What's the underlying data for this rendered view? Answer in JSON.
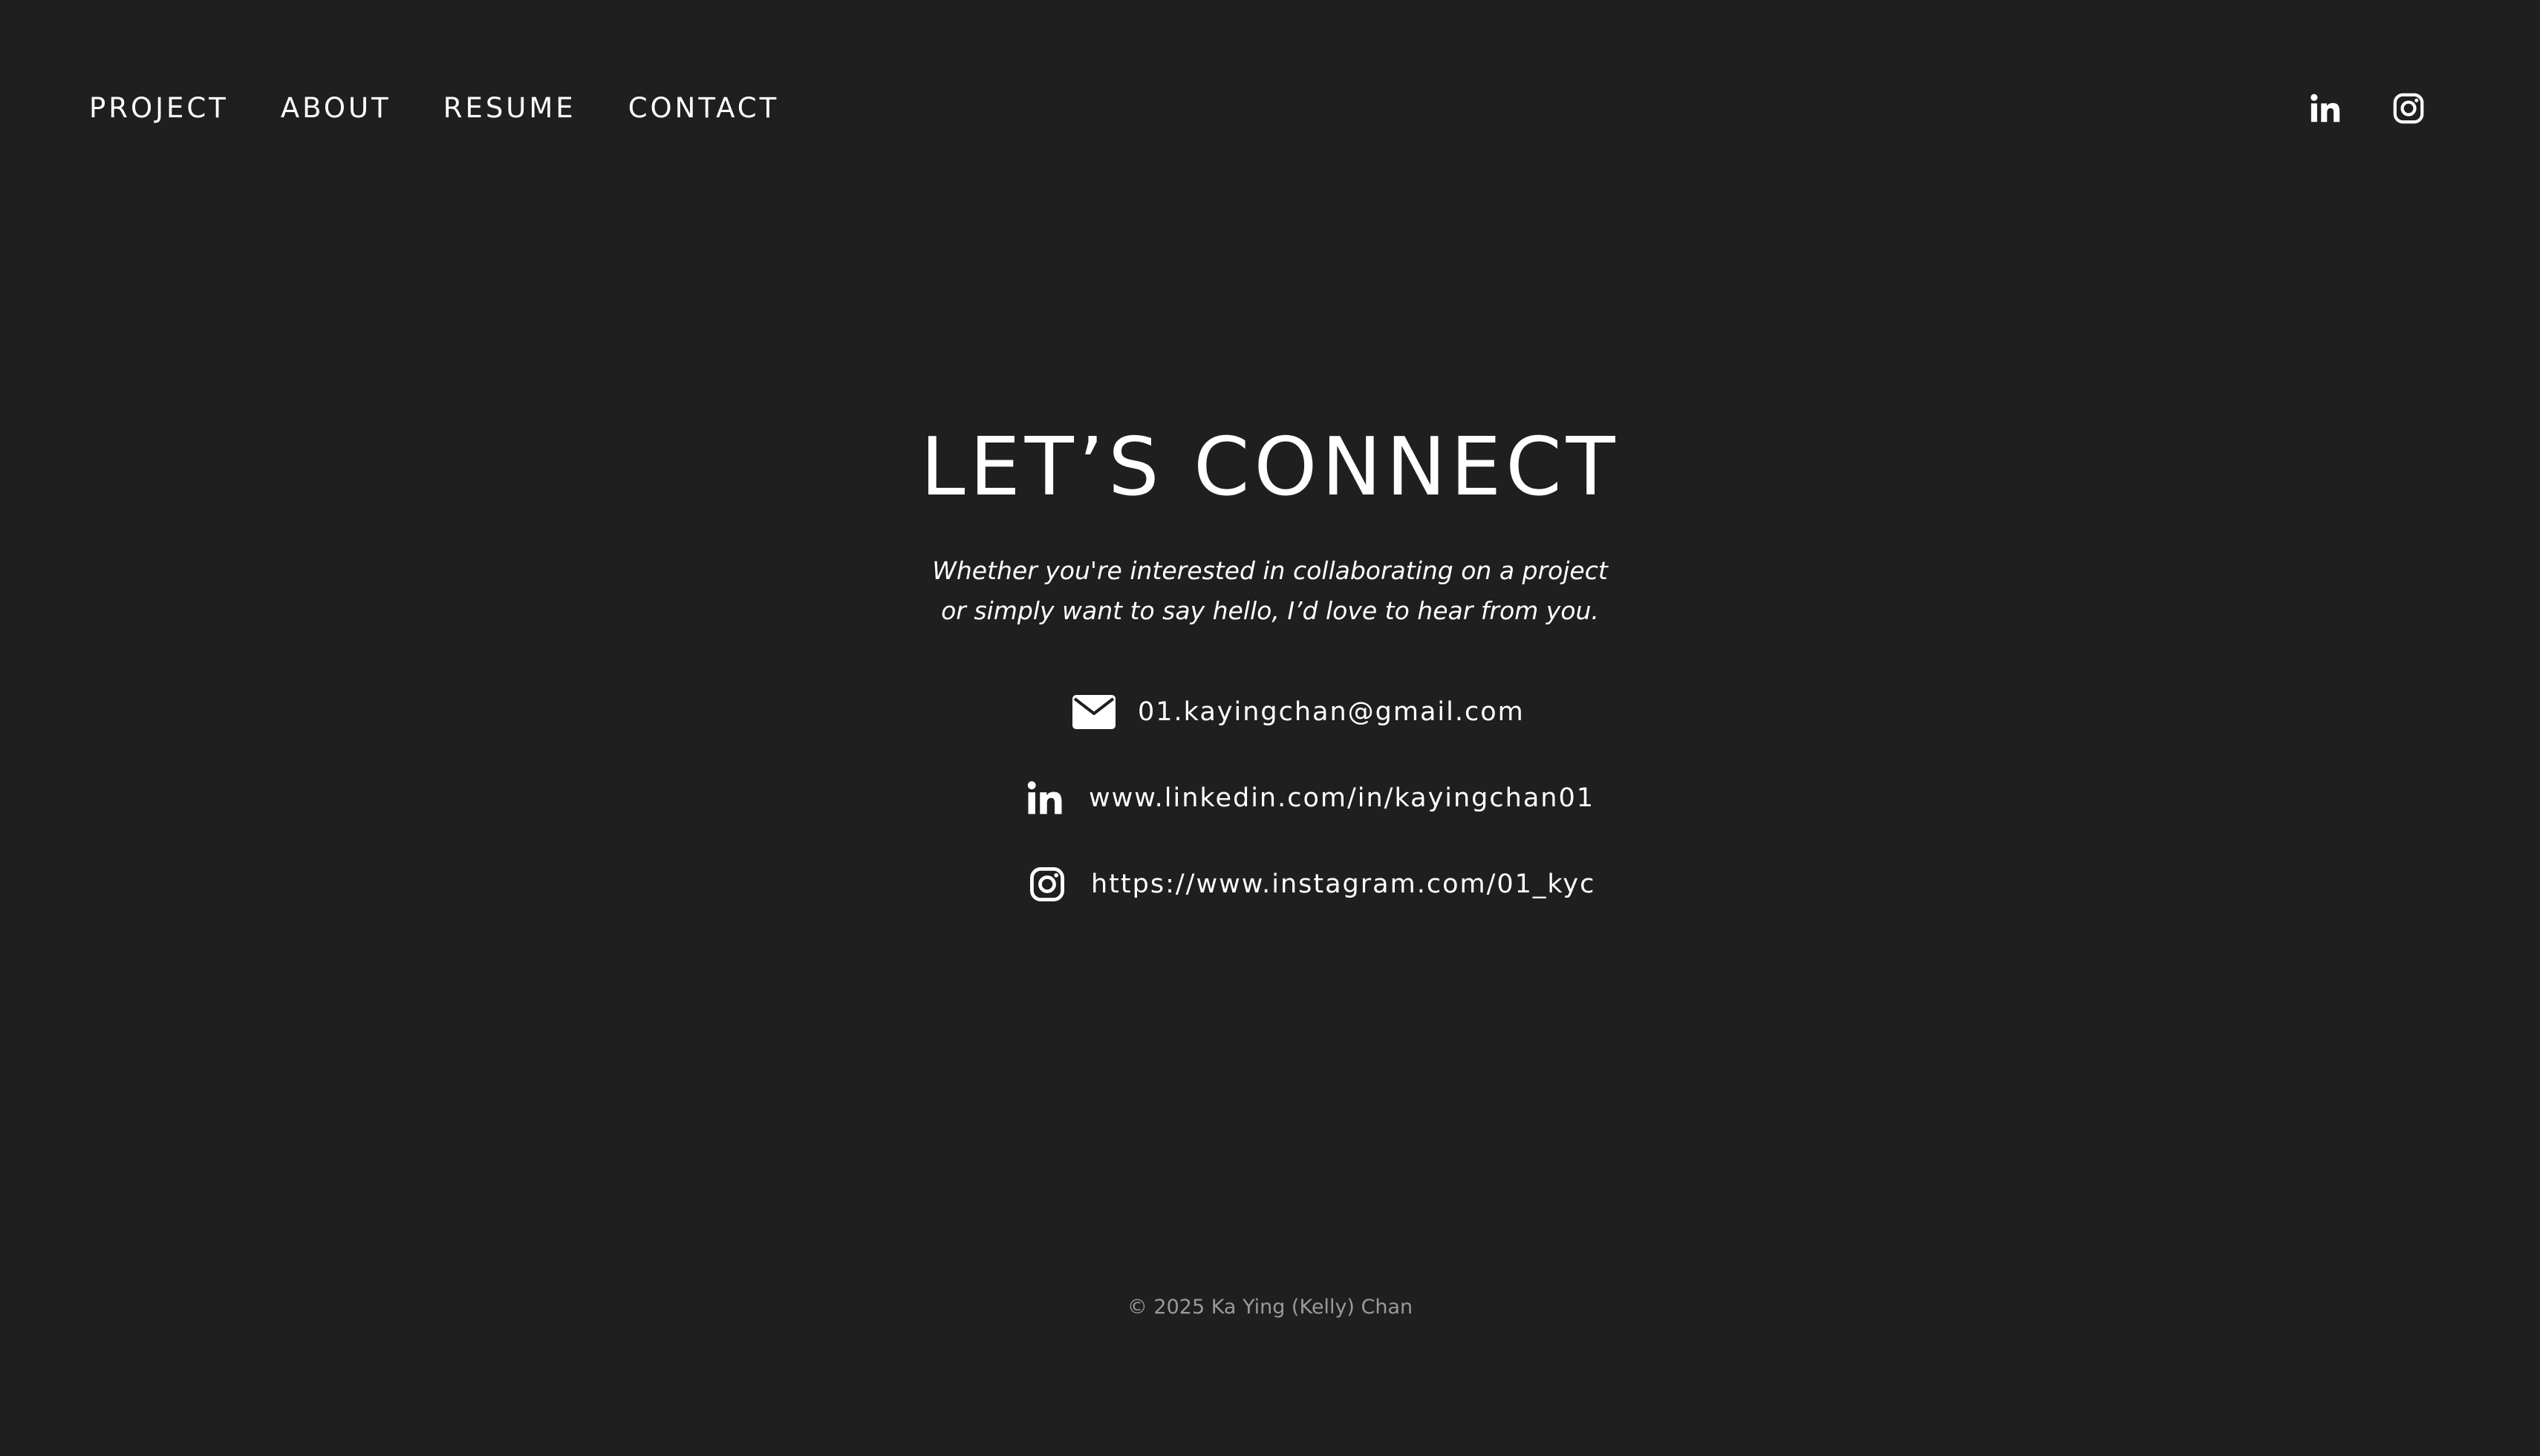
{
  "nav": {
    "items": [
      {
        "label": "PROJECT"
      },
      {
        "label": "ABOUT"
      },
      {
        "label": "RESUME"
      },
      {
        "label": "CONTACT"
      }
    ],
    "social": [
      {
        "icon": "linkedin-icon"
      },
      {
        "icon": "instagram-icon"
      }
    ]
  },
  "main": {
    "title": "LET’S CONNECT",
    "subtitle_line1": "Whether you're interested in collaborating on a project",
    "subtitle_line2": "or simply want to say hello, I’d love to hear from you.",
    "contacts": [
      {
        "icon": "mail-icon",
        "text": "01.kayingchan@gmail.com"
      },
      {
        "icon": "linkedin-icon",
        "text": "www.linkedin.com/in/kayingchan01"
      },
      {
        "icon": "instagram-icon",
        "text": "https://www.instagram.com/01_kyc"
      }
    ]
  },
  "footer": {
    "copyright": "© 2025 Ka Ying (Kelly) Chan"
  },
  "colors": {
    "background": "#1f1f1f",
    "text": "#ffffff",
    "footer_text": "#9a9a9a"
  }
}
